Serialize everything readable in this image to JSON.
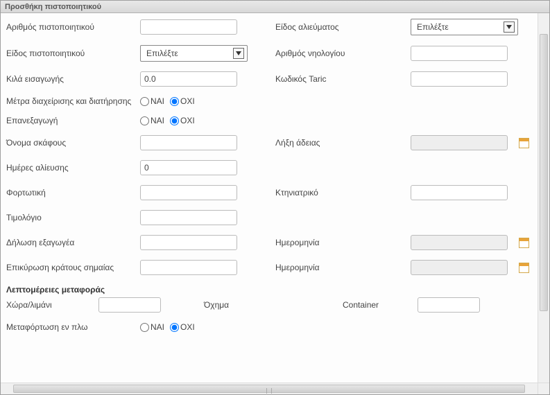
{
  "window": {
    "title": "Προσθήκη πιστοποιητικού"
  },
  "labels": {
    "cert_number": "Αριθμός πιστοποιητικού",
    "fishery_type": "Είδος αλιεύματος",
    "cert_type": "Είδος πιστοποιητικού",
    "register_number": "Αριθμός νηολογίου",
    "import_kg": "Κιλά εισαγωγής",
    "taric_code": "Κωδικός Taric",
    "mgmt_measures": "Μέτρα διαχείρισης και διατήρησης",
    "reexport": "Επανεξαγωγή",
    "vessel_name": "Όνομα σκάφους",
    "license_expiry": "Λήξη άδειας",
    "fishing_days": "Ημέρες αλίευσης",
    "bill_of_lading": "Φορτωτική",
    "veterinary": "Κτηνιατρικό",
    "invoice": "Τιμολόγιο",
    "exporter_decl": "Δήλωση εξαγωγέα",
    "date1": "Ημερομηνία",
    "flag_validation": "Επικύρωση κράτους σημαίας",
    "date2": "Ημερομηνία",
    "transport_section": "Λεπτομέρειες μεταφοράς",
    "country_port": "Χώρα/λιμάνι",
    "vehicle": "Όχημα",
    "container": "Container",
    "transship": "Μεταφόρτωση εν πλω"
  },
  "select": {
    "placeholder": "Επιλέξτε"
  },
  "values": {
    "cert_number": "",
    "fishery_type": "",
    "cert_type": "",
    "register_number": "",
    "import_kg": "0.0",
    "taric_code": "",
    "vessel_name": "",
    "license_expiry": "",
    "fishing_days": "0",
    "bill_of_lading": "",
    "veterinary": "",
    "invoice": "",
    "exporter_decl": "",
    "date1": "",
    "flag_validation": "",
    "date2": "",
    "country_port": "",
    "vehicle": "",
    "container": ""
  },
  "radio": {
    "yes": "ΝΑΙ",
    "no": "ΟΧΙ"
  }
}
